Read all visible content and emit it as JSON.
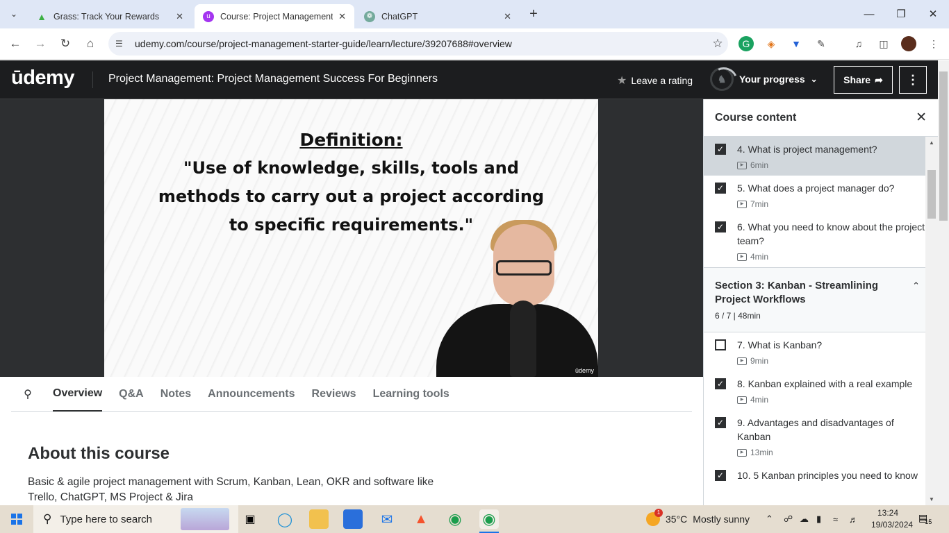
{
  "browser": {
    "tabs": [
      {
        "title": "Grass: Track Your Rewards",
        "active": false,
        "favicon": "grass-icon"
      },
      {
        "title": "Course: Project Management: P",
        "active": true,
        "favicon": "udemy-icon"
      },
      {
        "title": "ChatGPT",
        "active": false,
        "favicon": "chatgpt-icon"
      }
    ],
    "url": "udemy.com/course/project-management-starter-guide/learn/lecture/39207688#overview"
  },
  "header": {
    "logo": "ūdemy",
    "course_title": "Project Management: Project Management Success For Beginners",
    "rating_label": "Leave a rating",
    "progress_label": "Your progress",
    "share_label": "Share"
  },
  "video": {
    "slide_title": "Definition:",
    "slide_body": "\"Use of knowledge, skills, tools and methods to carry out a project according to specific requirements.\"",
    "watermark": "ūdemy"
  },
  "tabs": [
    "Overview",
    "Q&A",
    "Notes",
    "Announcements",
    "Reviews",
    "Learning tools"
  ],
  "about": {
    "heading": "About this course",
    "description": "Basic & agile project management with Scrum, Kanban, Lean, OKR and software like Trello, ChatGPT, MS Project & Jira"
  },
  "sidebar": {
    "title": "Course content",
    "lectures_top": [
      {
        "title": "4. What is project management?",
        "duration": "6min",
        "checked": true,
        "current": true
      },
      {
        "title": "5. What does a project manager do?",
        "duration": "7min",
        "checked": true,
        "current": false
      },
      {
        "title": "6. What you need to know about the project team?",
        "duration": "4min",
        "checked": true,
        "current": false
      }
    ],
    "section": {
      "title": "Section 3: Kanban - Streamlining Project Workflows",
      "meta": "6 / 7 | 48min"
    },
    "lectures_bottom": [
      {
        "title": "7. What is Kanban?",
        "duration": "9min",
        "checked": false
      },
      {
        "title": "8. Kanban explained with a real example",
        "duration": "4min",
        "checked": true
      },
      {
        "title": "9. Advantages and disadvantages of Kanban",
        "duration": "13min",
        "checked": true
      },
      {
        "title": "10. 5 Kanban principles you need to know",
        "duration": "",
        "checked": true
      }
    ]
  },
  "taskbar": {
    "search_placeholder": "Type here to search",
    "weather_temp": "35°C",
    "weather_desc": "Mostly sunny",
    "weather_badge": "1",
    "time": "13:24",
    "date": "19/03/2024",
    "notification_count": "15"
  }
}
